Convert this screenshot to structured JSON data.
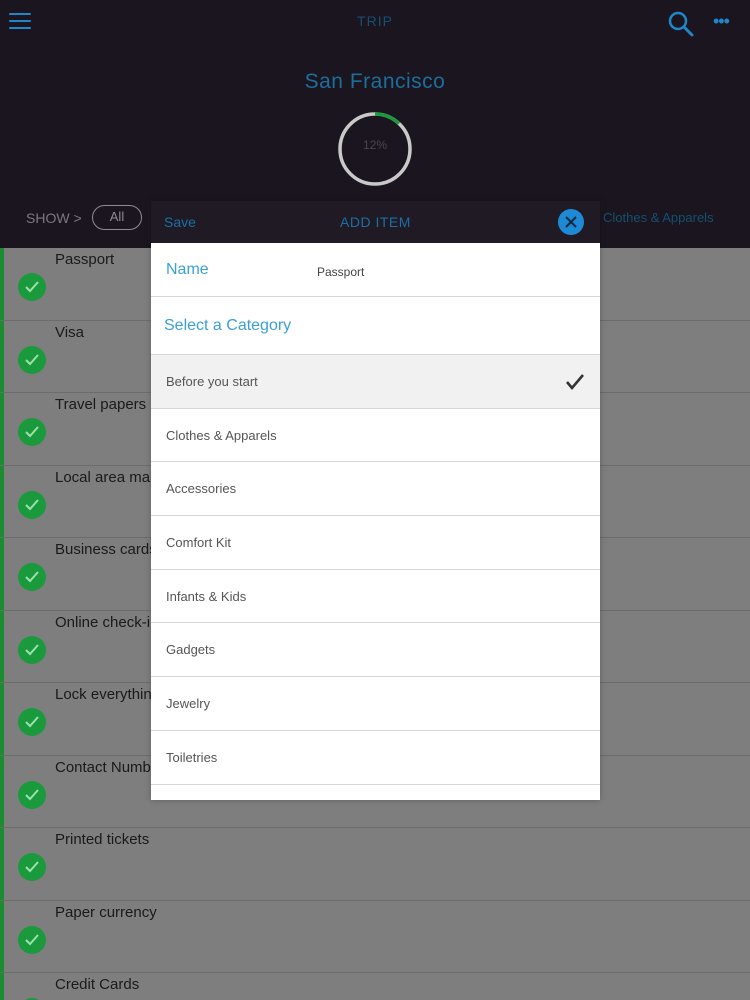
{
  "header": {
    "title": "TRIP",
    "city": "San Francisco",
    "progress": "12%",
    "progress_fraction": 0.12,
    "show_label": "SHOW >",
    "filter_all": "All",
    "filter_category": "Clothes & Apparels"
  },
  "list": {
    "items": [
      {
        "title": "Passport"
      },
      {
        "title": "Visa"
      },
      {
        "title": "Travel papers"
      },
      {
        "title": "Local area ma"
      },
      {
        "title": "Business cards"
      },
      {
        "title": "Online check-i"
      },
      {
        "title": "Lock everythin"
      },
      {
        "title": "Contact Numb"
      },
      {
        "title": "Printed tickets"
      },
      {
        "title": "Paper currency"
      },
      {
        "title": "Credit Cards"
      }
    ]
  },
  "modal": {
    "save_label": "Save",
    "title": "ADD ITEM",
    "name_label": "Name",
    "name_value": "Passport",
    "category_label": "Select a Category",
    "categories": [
      {
        "label": "Before you start",
        "selected": true
      },
      {
        "label": "Clothes & Apparels",
        "selected": false
      },
      {
        "label": "Accessories",
        "selected": false
      },
      {
        "label": "Comfort Kit",
        "selected": false
      },
      {
        "label": "Infants & Kids",
        "selected": false
      },
      {
        "label": "Gadgets",
        "selected": false
      },
      {
        "label": "Jewelry",
        "selected": false
      },
      {
        "label": "Toiletries",
        "selected": false
      }
    ]
  },
  "colors": {
    "accent": "#1f87c9",
    "header_bg": "#1b1520",
    "complete_green": "#1a9a3c",
    "category_text": "#3b9fd8"
  },
  "icons": [
    "menu-icon",
    "search-icon",
    "more-icon",
    "close-icon",
    "check-icon"
  ]
}
